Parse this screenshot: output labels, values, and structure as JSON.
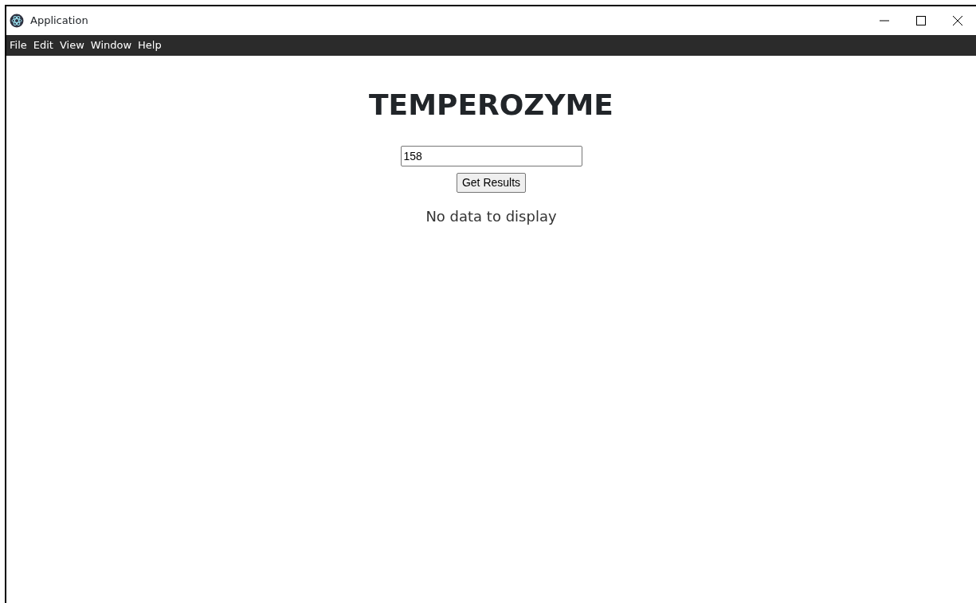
{
  "window": {
    "title": "Application"
  },
  "menu": [
    "File",
    "Edit",
    "View",
    "Window",
    "Help"
  ],
  "heading": "TEMPEROZYME",
  "input": {
    "value": "158"
  },
  "button": "Get Results",
  "message": "No data to display"
}
